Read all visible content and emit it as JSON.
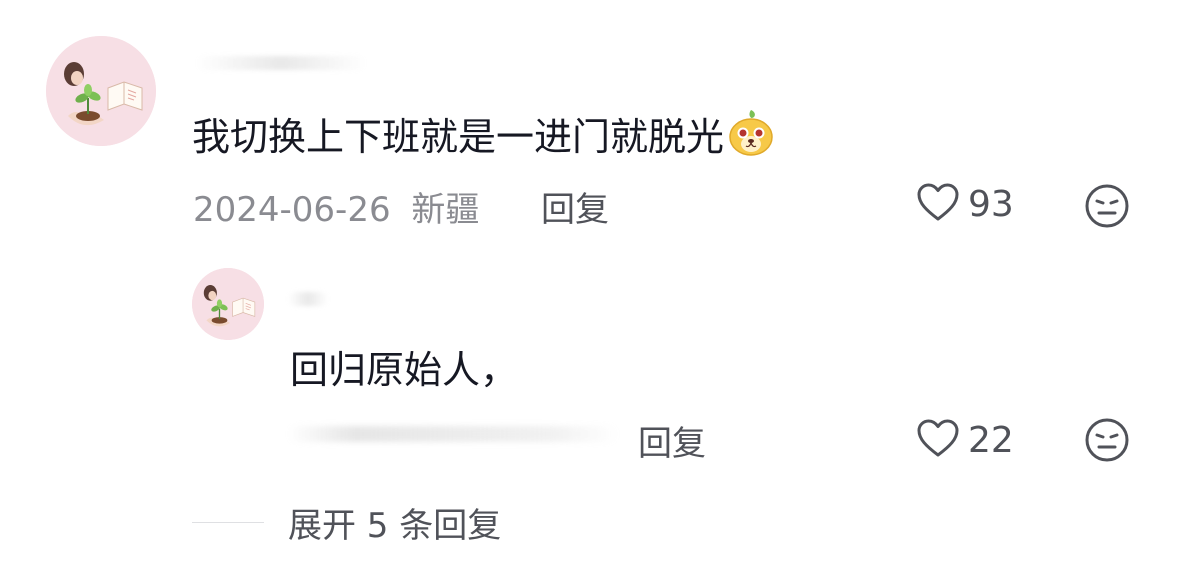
{
  "comment": {
    "text": "我切换上下班就是一进门就脱光",
    "emoji_icon": "yellow-dog-face-emoji-icon",
    "date": "2024-06-26",
    "location": "新疆",
    "reply_label": "回复",
    "like_count": "93",
    "like_icon": "heart-outline-icon",
    "dislike_icon": "meh-face-icon"
  },
  "reply": {
    "text": "回归原始人，",
    "reply_label": "回复",
    "like_count": "22",
    "like_icon": "heart-outline-icon",
    "dislike_icon": "meh-face-icon"
  },
  "expand": {
    "label": "展开 5 条回复"
  },
  "colors": {
    "text": "#161823",
    "meta": "#8a8b91",
    "action": "#505259",
    "avatar_bg": "#f6dce3"
  }
}
